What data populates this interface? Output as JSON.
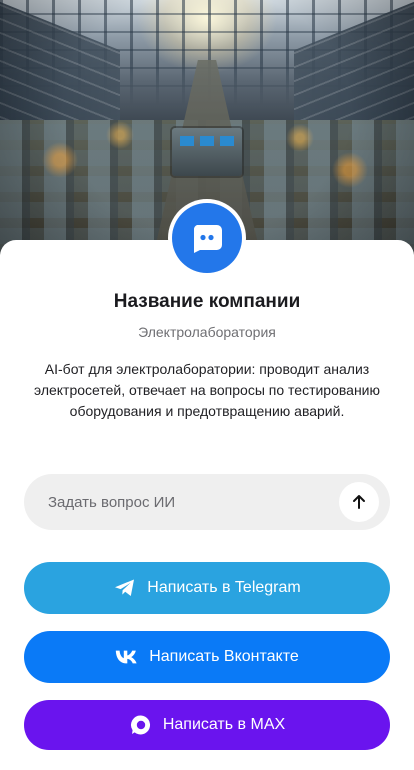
{
  "company": {
    "name": "Название компании",
    "type": "Электролаборатория",
    "description": "AI-бот для электролаборатории: проводит анализ электросетей, отвечает на вопросы по тестированию оборудования и предотвращению аварий."
  },
  "ask": {
    "placeholder": "Задать вопрос ИИ",
    "send_icon": "arrow-up-icon"
  },
  "buttons": {
    "telegram": {
      "label": "Написать в Telegram",
      "icon": "telegram-icon",
      "color": "#2aa3e0"
    },
    "vk": {
      "label": "Написать Вконтакте",
      "icon": "vk-icon",
      "color": "#0a7af7"
    },
    "max": {
      "label": "Написать в MAX",
      "icon": "max-icon",
      "color": "#6a14ee"
    }
  },
  "avatar": {
    "icon": "chat-bubble-icon",
    "color": "#2377ea"
  },
  "hero": {
    "image": "electrical-laboratory-factory-hall"
  }
}
